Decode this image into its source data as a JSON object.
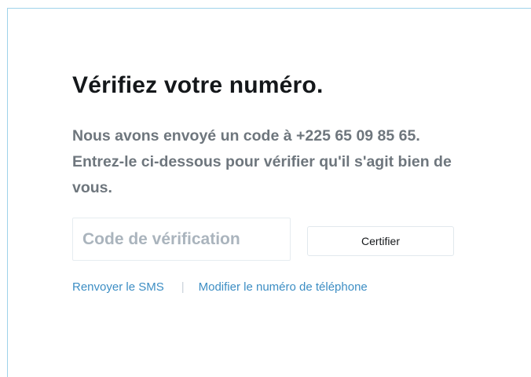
{
  "verify": {
    "title": "Vérifiez votre numéro.",
    "description": "Nous avons envoyé un code à +225 65 09 85 65. Entrez-le ci-dessous pour vérifier qu'il s'agit bien de vous.",
    "code_placeholder": "Code de vérification",
    "code_value": "",
    "submit_label": "Certifier",
    "resend_link": "Renvoyer le SMS",
    "separator": "|",
    "change_number_link": "Modifier le numéro de téléphone"
  },
  "colors": {
    "title": "#14171a",
    "description": "#6e767d",
    "link": "#3d8ec4",
    "panel_border": "#9fd3ea",
    "input_border": "#e6ecf0"
  }
}
